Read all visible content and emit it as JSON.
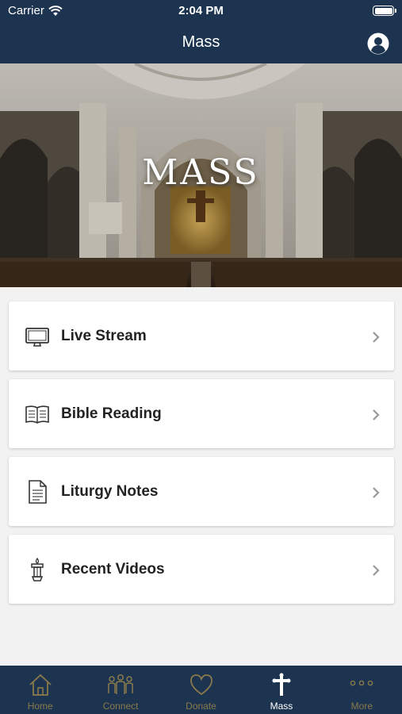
{
  "status_bar": {
    "carrier": "Carrier",
    "time": "2:04 PM"
  },
  "nav": {
    "title": "Mass",
    "profile_icon": "user-circle-icon"
  },
  "hero": {
    "title": "MASS"
  },
  "menu": [
    {
      "label": "Live Stream",
      "icon": "monitor-icon"
    },
    {
      "label": "Bible Reading",
      "icon": "open-book-icon"
    },
    {
      "label": "Liturgy Notes",
      "icon": "document-icon"
    },
    {
      "label": "Recent Videos",
      "icon": "candle-icon"
    }
  ],
  "tabs": [
    {
      "label": "Home",
      "icon": "home-icon",
      "active": false
    },
    {
      "label": "Connect",
      "icon": "people-icon",
      "active": false
    },
    {
      "label": "Donate",
      "icon": "heart-icon",
      "active": false
    },
    {
      "label": "Mass",
      "icon": "cross-icon",
      "active": true
    },
    {
      "label": "More",
      "icon": "more-icon",
      "active": false
    }
  ],
  "colors": {
    "navy": "#1c3450",
    "gold": "#8a7a4a",
    "active": "#ffffff"
  }
}
